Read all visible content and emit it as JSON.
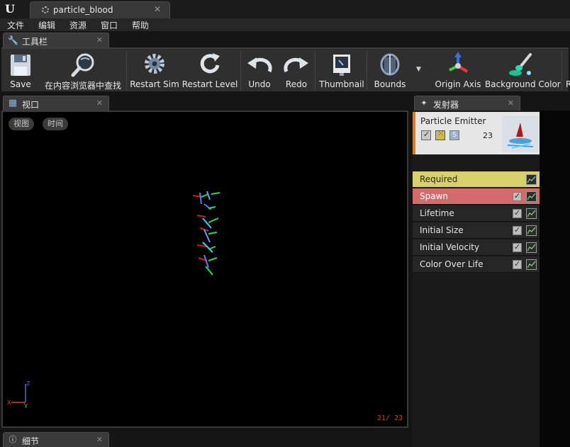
{
  "window": {
    "tab_title": "particle_blood"
  },
  "menu": {
    "items": [
      "文件",
      "编辑",
      "资源",
      "窗口",
      "帮助"
    ]
  },
  "toolbar_panel": {
    "title": "工具栏"
  },
  "toolbar": {
    "save": "Save",
    "find_in_cb": "在内容浏览器中查找",
    "restart_sim": "Restart Sim",
    "restart_level": "Restart Level",
    "undo": "Undo",
    "redo": "Redo",
    "thumbnail": "Thumbnail",
    "bounds": "Bounds",
    "origin_axis": "Origin Axis",
    "background_color": "Background Color",
    "overflow": "R"
  },
  "viewport_panel": {
    "title": "视口"
  },
  "viewport": {
    "view_button": "视图",
    "time_button": "时间",
    "counter": "21/  23",
    "axis_x": "X",
    "axis_y": "Y",
    "axis_z": "Z"
  },
  "details_panel": {
    "title": "细节"
  },
  "emitters_panel": {
    "title": "发射器"
  },
  "emitter": {
    "name": "Particle Emitter",
    "count": "23",
    "solo_label": "S",
    "modules": [
      "Required",
      "Spawn",
      "Lifetime",
      "Initial Size",
      "Initial Velocity",
      "Color Over Life"
    ]
  },
  "colors": {
    "required": "#d8d06a",
    "spawn": "#d46b6b",
    "emitter_accent": "#e07a1f",
    "counter": "#c0452a"
  }
}
